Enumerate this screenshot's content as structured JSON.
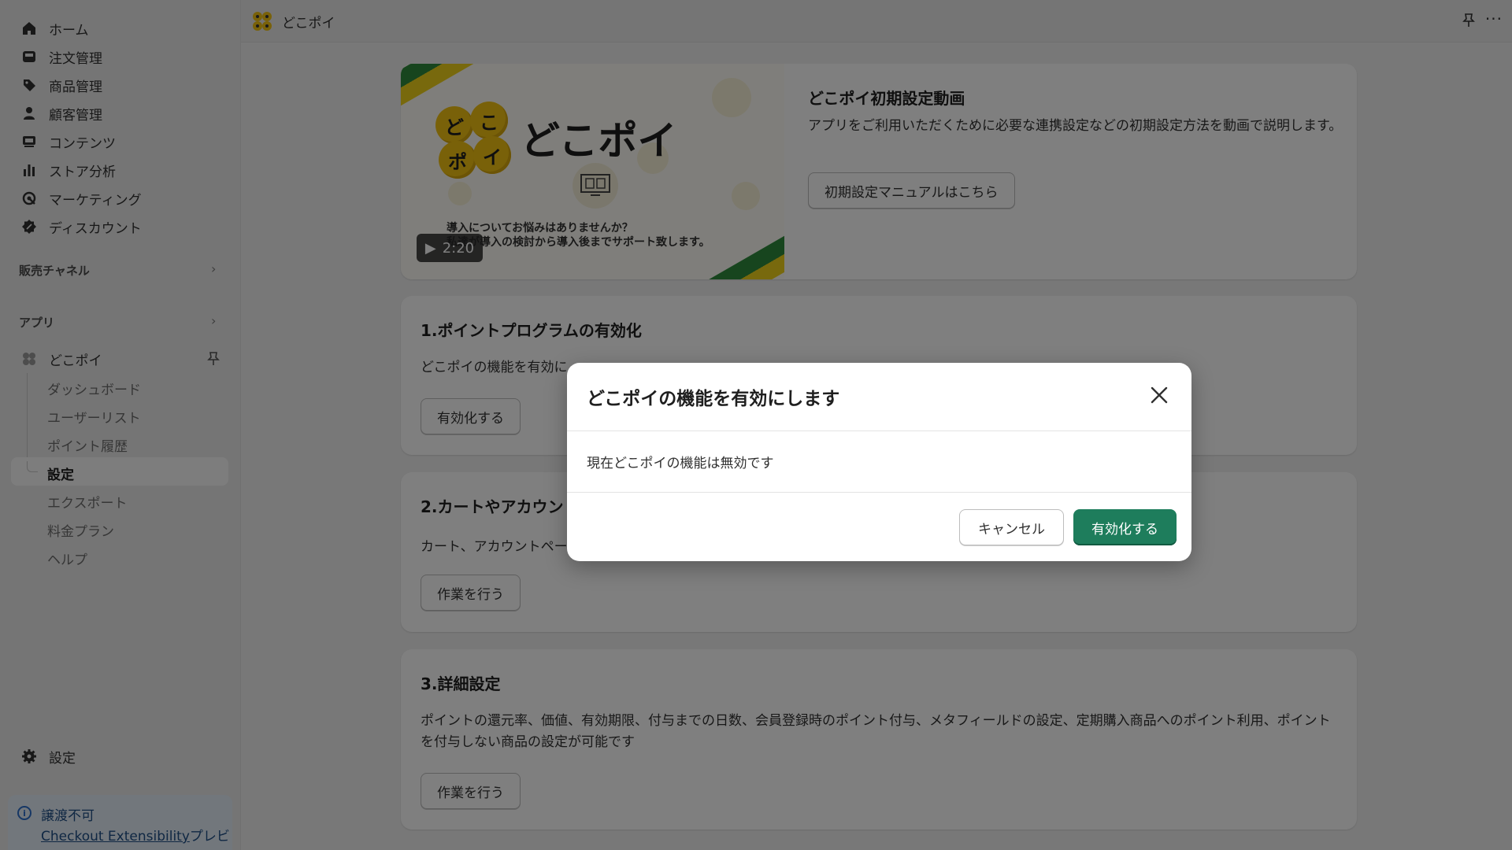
{
  "sidebar": {
    "nav": [
      {
        "label": "ホーム",
        "icon": "home-icon"
      },
      {
        "label": "注文管理",
        "icon": "inbox-icon"
      },
      {
        "label": "商品管理",
        "icon": "tag-icon"
      },
      {
        "label": "顧客管理",
        "icon": "person-icon"
      },
      {
        "label": "コンテンツ",
        "icon": "content-icon"
      },
      {
        "label": "ストア分析",
        "icon": "bar-chart-icon"
      },
      {
        "label": "マーケティング",
        "icon": "target-icon"
      },
      {
        "label": "ディスカウント",
        "icon": "discount-icon"
      }
    ],
    "sales_channels_label": "販売チャネル",
    "apps_label": "アプリ",
    "app": {
      "name": "どこポイ",
      "sub_items": [
        "ダッシュボード",
        "ユーザーリスト",
        "ポイント履歴",
        "設定",
        "エクスポート",
        "料金プラン",
        "ヘルプ"
      ],
      "active_item": "設定"
    },
    "settings_label": "設定",
    "notice": {
      "title": "譲渡不可",
      "link_text": "Checkout Extensibility",
      "suffix": "プレビ"
    }
  },
  "topbar": {
    "app_title": "どこポイ"
  },
  "video_card": {
    "thumb_title": "どこポイ",
    "thumb_coins": [
      "ど",
      "こ",
      "ポ",
      "イ"
    ],
    "thumb_caption_line1": "導入についてお悩みはありませんか？",
    "thumb_caption_line2": "私達が導入の検討から導入後までサポート致します。",
    "duration": "2:20",
    "heading": "どこポイ初期設定動画",
    "description": "アプリをご利用いただくために必要な連携設定などの初期設定方法を動画で説明します。",
    "button_label": "初期設定マニュアルはこちら"
  },
  "steps": [
    {
      "title": "1.ポイントプログラムの有効化",
      "text": "どこポイの機能を有効に",
      "button": "有効化する"
    },
    {
      "title": "2.カートやアカウン",
      "text": "カート、アカウントペー",
      "button": "作業を行う"
    },
    {
      "title": "3.詳細設定",
      "text": "ポイントの還元率、価値、有効期限、付与までの日数、会員登録時のポイント付与、メタフィールドの設定、定期購入商品へのポイント利用、ポイントを付与しない商品の設定が可能です",
      "button": "作業を行う"
    }
  ],
  "modal": {
    "title": "どこポイの機能を有効にします",
    "body": "現在どこポイの機能は無効です",
    "cancel_label": "キャンセル",
    "confirm_label": "有効化する"
  },
  "colors": {
    "primary_button": "#1e7d5c",
    "brand_yellow": "#f3c312",
    "brand_green": "#2f8a3c"
  }
}
